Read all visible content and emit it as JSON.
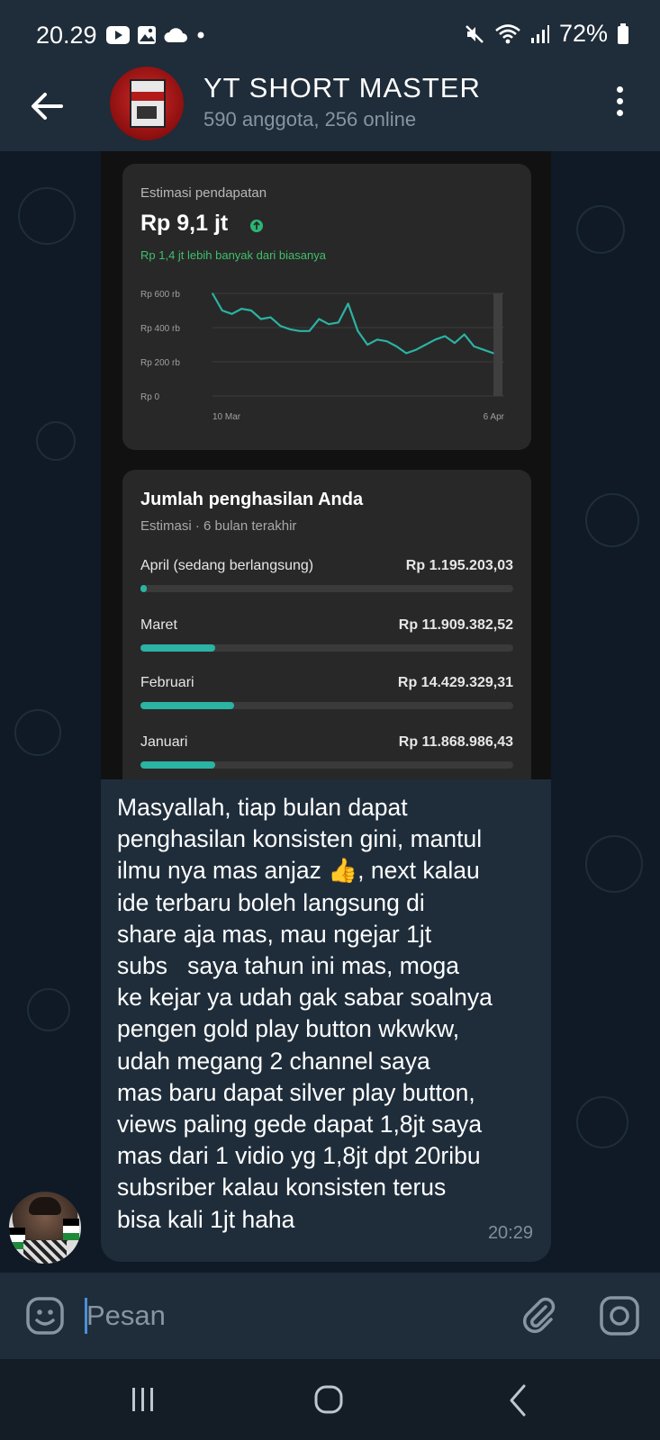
{
  "status_bar": {
    "time": "20.29",
    "battery": "72%",
    "icons": [
      "youtube-icon",
      "gallery-icon",
      "cloud-icon",
      "dot-icon",
      "mute-icon",
      "wifi-icon",
      "signal-icon",
      "battery-icon"
    ]
  },
  "header": {
    "title": "YT SHORT MASTER",
    "subtitle": "590 anggota, 256 online",
    "icons": [
      "back-arrow-icon",
      "group-avatar",
      "more-vert-icon"
    ]
  },
  "screenshot_card1": {
    "label": "Estimasi pendapatan",
    "amount": "Rp 9,1 jt",
    "comparison": "Rp 1,4 jt lebih banyak dari biasanya",
    "colors": {
      "line": "#2bb3a3",
      "up_badge": "#2bb673",
      "comparison_text": "#3fbf6b"
    }
  },
  "chart_data": {
    "type": "line",
    "title": "",
    "xlabel": "",
    "ylabel": "",
    "x_tick_labels": [
      "10 Mar",
      "6 Apr"
    ],
    "y_tick_labels": [
      "Rp 600 rb",
      "Rp 400 rb",
      "Rp 200 rb",
      "Rp 0"
    ],
    "ylim": [
      0,
      600
    ],
    "grid": true,
    "series": [
      {
        "values": [
          600,
          500,
          480,
          510,
          500,
          450,
          460,
          410,
          390,
          380,
          380,
          450,
          420,
          430,
          540,
          380,
          300,
          330,
          320,
          290,
          250,
          270,
          300,
          330,
          350,
          310,
          360,
          290,
          270,
          250
        ]
      }
    ]
  },
  "screenshot_card2": {
    "title": "Jumlah penghasilan Anda",
    "subtitle": "Estimasi · 6 bulan terakhir",
    "rows": [
      {
        "month": "April (sedang berlangsung)",
        "amount": "Rp 1.195.203,03",
        "progress": 0.018
      },
      {
        "month": "Maret",
        "amount": "Rp 11.909.382,52",
        "progress": 0.2
      },
      {
        "month": "Februari",
        "amount": "Rp 14.429.329,31",
        "progress": 0.25
      },
      {
        "month": "Januari",
        "amount": "Rp 11.868.986,43",
        "progress": 0.2
      }
    ]
  },
  "message": {
    "text": "Masyallah, tiap bulan dapat\npenghasilan konsisten gini, mantul\nilmu nya mas anjaz 👍, next kalau\nide terbaru boleh langsung di\nshare aja mas, mau ngejar 1jt\nsubs   saya tahun ini mas, moga\nke kejar ya udah gak sabar soalnya\npengen gold play button wkwkw,\nudah megang 2 channel saya\nmas baru dapat silver play button,\nviews paling gede dapat 1,8jt saya\nmas dari 1 vidio yg 1,8jt dpt 20ribu\nsubsriber kalau konsisten terus\nbisa kali 1jt haha",
    "time": "20:29"
  },
  "input": {
    "placeholder": "Pesan",
    "icons": [
      "emoji-icon",
      "attach-icon",
      "camera-icon"
    ]
  },
  "nav": {
    "icons": [
      "recent-apps-icon",
      "home-icon",
      "back-icon"
    ]
  }
}
